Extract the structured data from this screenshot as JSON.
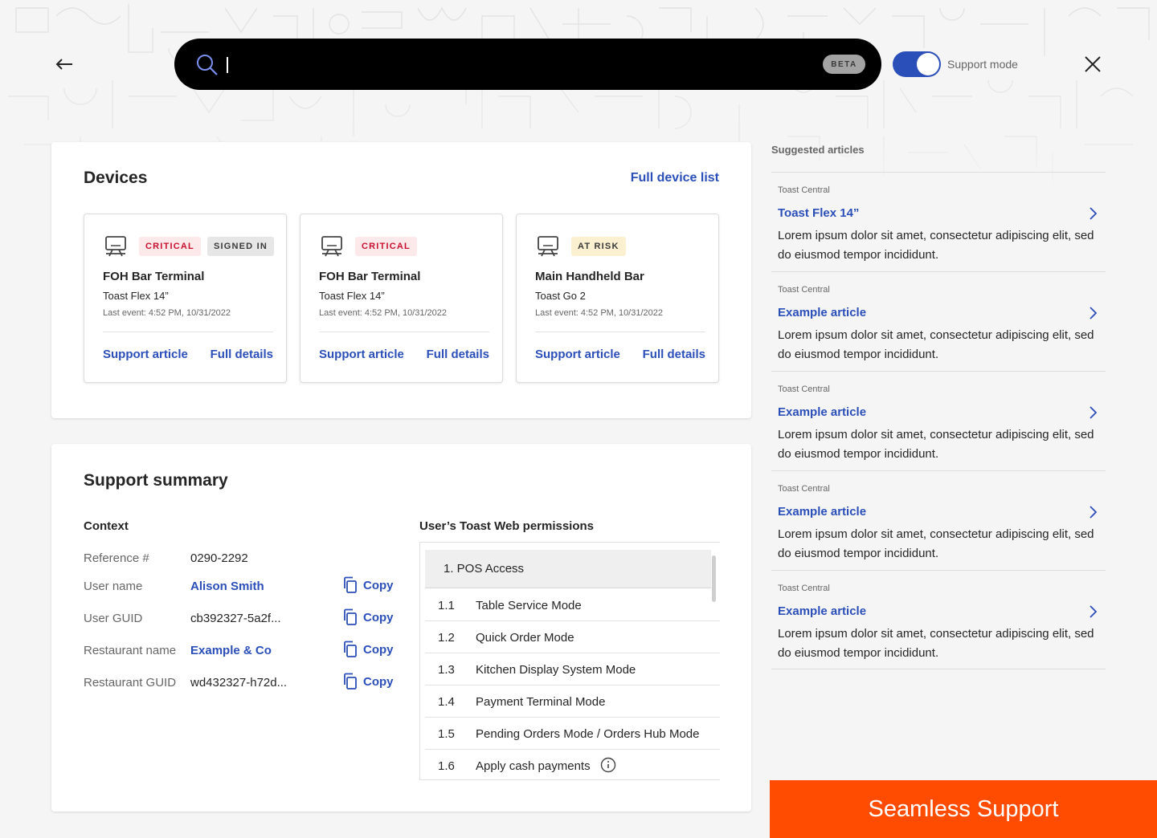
{
  "topbar": {
    "search_placeholder": "",
    "beta_label": "BETA",
    "support_mode_label": "Support mode",
    "support_mode_on": true
  },
  "devices": {
    "title": "Devices",
    "full_list_label": "Full device list",
    "items": [
      {
        "badges": [
          "CRITICAL",
          "SIGNED IN"
        ],
        "name": "FOH Bar Terminal",
        "model": "Toast Flex 14”",
        "last_event": "Last event: 4:52 PM, 10/31/2022",
        "support_label": "Support article",
        "details_label": "Full details"
      },
      {
        "badges": [
          "CRITICAL"
        ],
        "name": "FOH Bar Terminal",
        "model": "Toast Flex 14”",
        "last_event": "Last event: 4:52 PM, 10/31/2022",
        "support_label": "Support article",
        "details_label": "Full details"
      },
      {
        "badges": [
          "AT RISK"
        ],
        "name": "Main Handheld Bar",
        "model": "Toast Go 2",
        "last_event": "Last event: 4:52 PM, 10/31/2022",
        "support_label": "Support article",
        "details_label": "Full details"
      }
    ]
  },
  "summary": {
    "title": "Support summary",
    "context_title": "Context",
    "copy_label": "Copy",
    "rows": [
      {
        "label": "Reference #",
        "value": "0290-2292"
      },
      {
        "label": "User name",
        "value": "Alison Smith"
      },
      {
        "label": "User GUID",
        "value": "cb392327-5a2f..."
      },
      {
        "label": "Restaurant name",
        "value": "Example & Co"
      },
      {
        "label": "Restaurant GUID",
        "value": "wd432327-h72d..."
      }
    ],
    "permissions_title": "User’s Toast Web permissions",
    "permissions_group": "1.  POS Access",
    "permissions": [
      {
        "num": "1.1",
        "label": "Table Service Mode"
      },
      {
        "num": "1.2",
        "label": "Quick Order Mode"
      },
      {
        "num": "1.3",
        "label": "Kitchen Display System Mode"
      },
      {
        "num": "1.4",
        "label": "Payment Terminal Mode"
      },
      {
        "num": "1.5",
        "label": "Pending Orders Mode / Orders Hub Mode"
      },
      {
        "num": "1.6",
        "label": "Apply cash payments"
      }
    ]
  },
  "articles": {
    "title": "Suggested articles",
    "items": [
      {
        "source": "Toast Central",
        "title": "Toast Flex 14”",
        "desc": "Lorem ipsum dolor sit amet, consectetur adipiscing elit, sed do eiusmod tempor incididunt."
      },
      {
        "source": "Toast Central",
        "title": "Example article",
        "desc": "Lorem ipsum dolor sit amet, consectetur adipiscing elit, sed do eiusmod tempor incididunt."
      },
      {
        "source": "Toast Central",
        "title": "Example article",
        "desc": "Lorem ipsum dolor sit amet, consectetur adipiscing elit, sed do eiusmod tempor incididunt."
      },
      {
        "source": "Toast Central",
        "title": "Example article",
        "desc": "Lorem ipsum dolor sit amet, consectetur adipiscing elit, sed do eiusmod tempor incididunt."
      },
      {
        "source": "Toast Central",
        "title": "Example article",
        "desc": "Lorem ipsum dolor sit amet, consectetur adipiscing elit, sed do eiusmod tempor incididunt."
      }
    ]
  },
  "banner": {
    "label": "Seamless Support"
  },
  "colors": {
    "accent": "#2b4fb9",
    "critical": "#c8102e",
    "banner": "#ff4c00",
    "search_bg": "#000000"
  },
  "icons": [
    "arrow-left-icon",
    "search-icon",
    "close-icon",
    "terminal-icon",
    "copy-icon",
    "info-icon",
    "chevron-right-icon"
  ]
}
